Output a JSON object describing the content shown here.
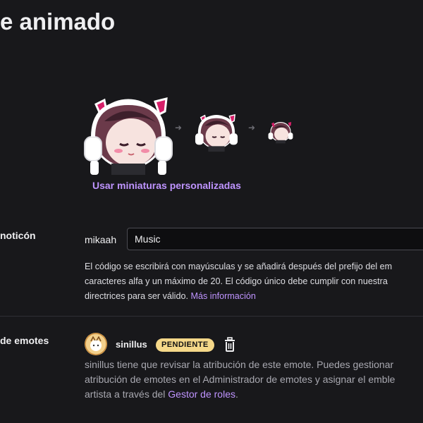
{
  "header": {
    "title": "e animado"
  },
  "preview": {
    "custom_thumbnails_link": "Usar miniaturas personalizadas"
  },
  "code_section": {
    "label": "noticón",
    "prefix": "mikaah",
    "input_value": "Music",
    "helper_lines": [
      "El código se escribirá con mayúsculas y se añadirá después del prefijo del em",
      "caracteres alfa y un máximo de 20. El código único debe cumplir con nuestra",
      "directrices para ser válido."
    ],
    "more_info_link": "Más información"
  },
  "attribution_section": {
    "label": "de emotes",
    "artist_name": "sinillus",
    "status_badge": "PENDIENTE",
    "description_lines": [
      "sinillus tiene que revisar la atribución de este emote. Puedes gestionar",
      "atribución de emotes en el Administrador de emotes y asignar el emble",
      "artista a través del"
    ],
    "roles_link": "Gestor de roles",
    "roles_link_suffix": "."
  },
  "colors": {
    "background": "#18181b",
    "accent": "#bf94ff",
    "badge": "#f5d889",
    "text": "#efeff1",
    "muted_text": "#a8a8b0"
  },
  "icons": [
    "arrow-right-icon",
    "trash-icon",
    "avatar-icon",
    "emote-preview-icon"
  ]
}
